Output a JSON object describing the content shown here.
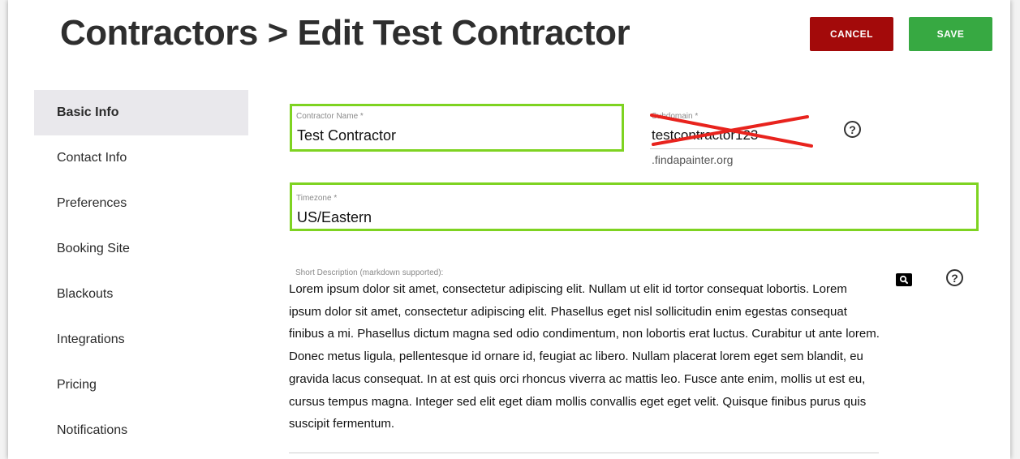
{
  "header": {
    "title": "Contractors > Edit Test Contractor",
    "cancel_label": "CANCEL",
    "save_label": "SAVE"
  },
  "sidebar": {
    "items": [
      {
        "label": "Basic Info",
        "active": true
      },
      {
        "label": "Contact Info"
      },
      {
        "label": "Preferences"
      },
      {
        "label": "Booking Site"
      },
      {
        "label": "Blackouts"
      },
      {
        "label": "Integrations"
      },
      {
        "label": "Pricing"
      },
      {
        "label": "Notifications"
      }
    ]
  },
  "form": {
    "contractor_name": {
      "label": "Contractor Name *",
      "value": "Test Contractor"
    },
    "subdomain": {
      "label": "Subdomain *",
      "value": "testcontractor123",
      "suffix": ".findapainter.org"
    },
    "timezone": {
      "label": "Timezone *",
      "value": "US/Eastern"
    },
    "short_description": {
      "label": "Short Description (markdown supported):",
      "value": "Lorem ipsum dolor sit amet, consectetur adipiscing elit. Nullam ut elit id tortor consequat lobortis. Lorem ipsum dolor sit amet, consectetur adipiscing elit. Phasellus eget nisl sollicitudin enim egestas consequat finibus a mi. Phasellus dictum magna sed odio condimentum, non lobortis erat luctus. Curabitur ut ante lorem. Donec metus ligula, pellentesque id ornare id, feugiat ac libero. Nullam placerat lorem eget sem blandit, eu gravida lacus consequat. In at est quis orci rhoncus viverra ac mattis leo. Fusce ante enim, mollis ut est eu, cursus tempus magna. Integer sed elit eget diam mollis convallis eget eget velit. Quisque finibus purus quis suscipit fermentum."
    }
  },
  "icons": {
    "help": "?",
    "preview": "search-icon"
  },
  "colors": {
    "cancel": "#a30a0a",
    "save": "#37a942",
    "highlight": "#7ed321",
    "strike": "#e8231d"
  }
}
